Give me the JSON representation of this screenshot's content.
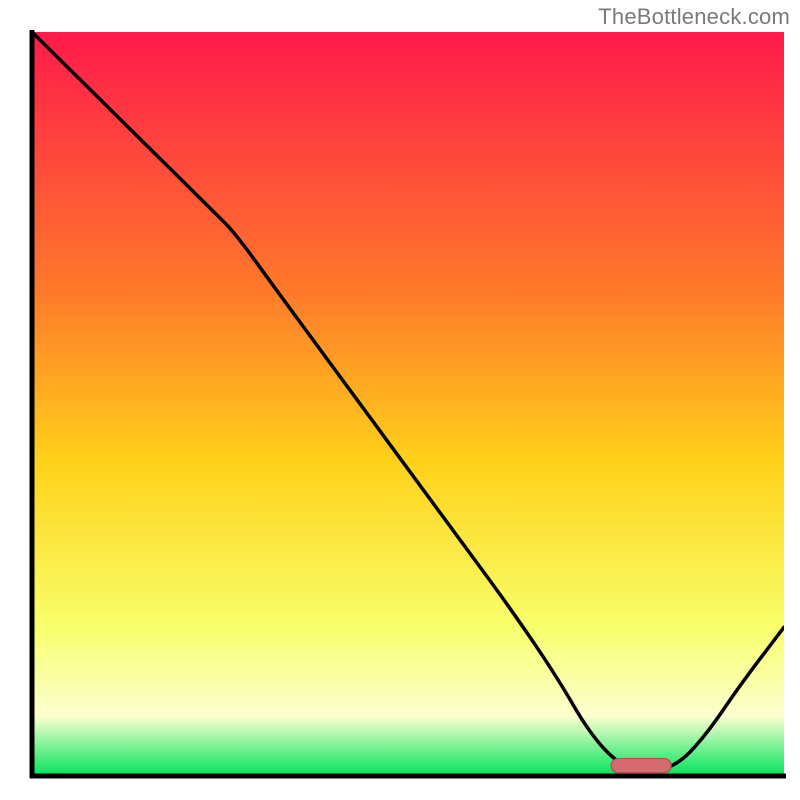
{
  "attribution": "TheBottleneck.com",
  "colors": {
    "gradient_top": "#ff1a4b",
    "gradient_upper": "#ff7a2a",
    "gradient_mid": "#ffd21a",
    "gradient_lower": "#f8ff6b",
    "gradient_pale": "#fbffd0",
    "gradient_green": "#00e35a",
    "curve": "#000000",
    "axis": "#000000",
    "marker_fill": "#d66a6f",
    "marker_stroke": "#b14e53"
  },
  "chart_data": {
    "type": "line",
    "title": "",
    "xlabel": "",
    "ylabel": "",
    "xlim": [
      0,
      100
    ],
    "ylim": [
      0,
      100
    ],
    "series": [
      {
        "name": "bottleneck-curve",
        "x": [
          0,
          8,
          16,
          24,
          27,
          32,
          40,
          48,
          56,
          64,
          70,
          74,
          78,
          82,
          86,
          90,
          94,
          100
        ],
        "y": [
          100,
          92,
          84,
          76,
          73,
          66,
          55,
          44,
          33,
          22,
          13,
          6,
          1.5,
          0.5,
          1.5,
          6,
          12,
          20
        ]
      }
    ],
    "marker": {
      "name": "optimal-range-marker",
      "x_start": 77,
      "x_end": 85,
      "y": 1.4
    },
    "note": "Values are estimated from pixel positions; the original image has no axis ticks or numeric labels."
  }
}
